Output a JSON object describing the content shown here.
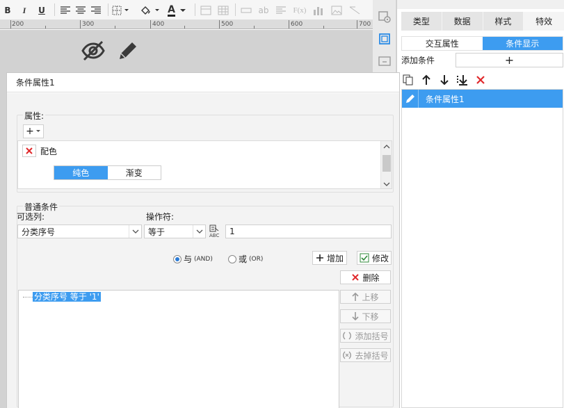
{
  "toolbar": {
    "bold": "B",
    "italic": "I",
    "underline": "U",
    "ab": "ab",
    "fx": "F(x)",
    "font_color": "A"
  },
  "ruler": {
    "labels": [
      "200",
      "300",
      "400",
      "500",
      "600",
      "700"
    ]
  },
  "right_panel": {
    "tabs": [
      "类型",
      "数据",
      "样式",
      "特效"
    ],
    "active_tab": "特效",
    "subtabs": [
      "交互属性",
      "条件显示"
    ],
    "active_subtab": "条件显示",
    "add_condition_label": "添加条件",
    "add_button": "+",
    "condition_items": [
      "条件属性1"
    ]
  },
  "dialog": {
    "title": "条件属性1",
    "attr_group_label": "属性:",
    "attr_add_button": "+",
    "attr_name": "配色",
    "color_mode_options": [
      "纯色",
      "渐变"
    ],
    "color_mode_selected": "纯色",
    "normal_cond_label": "普通条件",
    "column_label": "可选列:",
    "column_value": "分类序号",
    "operator_label": "操作符:",
    "operator_value": "等于",
    "value_input": "1",
    "radio_and": "与",
    "radio_and_tag": "(AND)",
    "radio_or": "或",
    "radio_or_tag": "(OR)",
    "selected_logic": "AND",
    "add_button": "增加",
    "modify_button": "修改",
    "conditions": [
      "分类序号 等于 '1'"
    ],
    "side_buttons": {
      "delete": "删除",
      "move_up": "上移",
      "move_down": "下移",
      "add_bracket": "添加括号",
      "remove_bracket": "去掉括号"
    }
  },
  "colors": {
    "accent": "#3d9cf0",
    "delete_red": "#e0282b",
    "canvas": "#d2d2d2"
  },
  "icons": [
    "hide-eye-icon",
    "pencil-icon",
    "paste-icon",
    "arrow-up-icon",
    "arrow-down-icon",
    "move-bottom-icon",
    "delete-icon",
    "edit-icon",
    "value-editor-icon"
  ]
}
